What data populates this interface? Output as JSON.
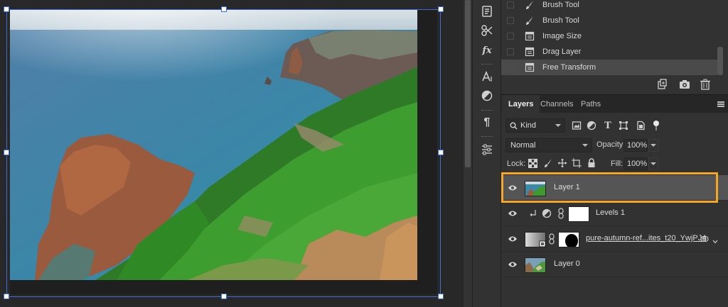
{
  "history": {
    "items": [
      {
        "label": "Brush Tool",
        "icon": "brush-icon"
      },
      {
        "label": "Brush Tool",
        "icon": "brush-icon"
      },
      {
        "label": "Image Size",
        "icon": "document-icon"
      },
      {
        "label": "Drag Layer",
        "icon": "document-icon"
      },
      {
        "label": "Free Transform",
        "icon": "document-icon"
      }
    ]
  },
  "tabs": [
    "Layers",
    "Channels",
    "Paths"
  ],
  "filter": {
    "kind": "Kind"
  },
  "blend": {
    "mode": "Normal",
    "opacity_label": "Opacity:",
    "opacity": "100%",
    "fill_label": "Fill:",
    "fill": "100%",
    "lock_label": "Lock:"
  },
  "layers": [
    {
      "name": "Layer 1",
      "selected": true
    },
    {
      "name": "Levels 1",
      "selected": false
    },
    {
      "name": "pure-autumn-ref...ites_t20_YwjPJ4",
      "selected": false
    },
    {
      "name": "Layer 0",
      "selected": false
    }
  ],
  "colors": {
    "accent": "#f6a623",
    "transform_box": "#3b6fd6"
  }
}
